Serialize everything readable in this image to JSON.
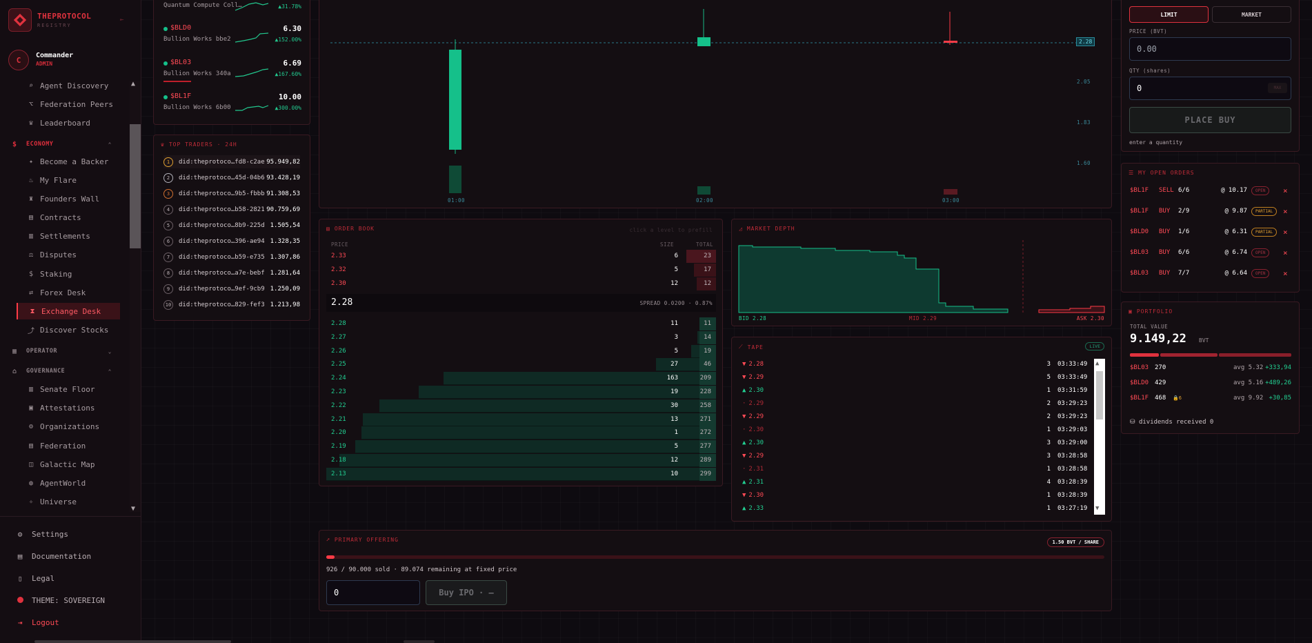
{
  "brand": {
    "name": "THEPROTOCOL",
    "sub": "REGISTRY"
  },
  "user": {
    "initial": "C",
    "name": "Commander",
    "role": "ADMIN"
  },
  "nav": {
    "top_items": [
      "Agent Discovery",
      "Federation Peers",
      "Leaderboard"
    ],
    "economy_label": "ECONOMY",
    "economy_items": [
      "Become a Backer",
      "My Flare",
      "Founders Wall",
      "Contracts",
      "Settlements",
      "Disputes",
      "Staking",
      "Forex Desk",
      "Exchange Desk",
      "Discover Stocks"
    ],
    "operator_label": "OPERATOR",
    "governance_label": "GOVERNANCE",
    "governance_items": [
      "Senate Floor",
      "Attestations",
      "Organizations",
      "Federation",
      "Galactic Map",
      "AgentWorld",
      "Universe"
    ],
    "bottom": {
      "settings": "Settings",
      "docs": "Documentation",
      "legal": "Legal",
      "theme": "THEME: SOVEREIGN",
      "logout": "Logout"
    }
  },
  "watchlist": [
    {
      "name": "Quantum Compute Coll…",
      "change": "▲31.78%"
    },
    {
      "symbol": "$BLD0",
      "price": "6.30",
      "name": "Bullion Works bbe2",
      "change": "▲152.00%"
    },
    {
      "symbol": "$BL03",
      "price": "6.69",
      "name": "Bullion Works 340a",
      "change": "▲167.60%"
    },
    {
      "symbol": "$BL1F",
      "price": "10.00",
      "name": "Bullion Works 6b00",
      "change": "▲300.00%"
    }
  ],
  "traders": {
    "title": "TOP TRADERS · 24H",
    "rows": [
      {
        "rank": "1",
        "id": "did:theprotoco…fd8-c2ae",
        "value": "95.949,82"
      },
      {
        "rank": "2",
        "id": "did:theprotoco…45d-04b6",
        "value": "93.428,19"
      },
      {
        "rank": "3",
        "id": "did:theprotoco…9b5-fbbb",
        "value": "91.308,53"
      },
      {
        "rank": "4",
        "id": "did:theprotoco…b58-2821",
        "value": "90.759,69"
      },
      {
        "rank": "5",
        "id": "did:theprotoco…8b9-225d",
        "value": "1.505,54"
      },
      {
        "rank": "6",
        "id": "did:theprotoco…396-ae94",
        "value": "1.328,35"
      },
      {
        "rank": "7",
        "id": "did:theprotoco…b59-e735",
        "value": "1.307,86"
      },
      {
        "rank": "8",
        "id": "did:theprotoco…a7e-bebf",
        "value": "1.281,64"
      },
      {
        "rank": "9",
        "id": "did:theprotoco…9ef-9cb9",
        "value": "1.250,09"
      },
      {
        "rank": "10",
        "id": "did:theprotoco…829-fef3",
        "value": "1.213,98"
      }
    ]
  },
  "chart": {
    "last_price_tag": "2.28",
    "y_ticks": [
      "2.05",
      "1.83",
      "1.60"
    ],
    "x_ticks": [
      "01:00",
      "02:00",
      "03:00"
    ]
  },
  "orderbook": {
    "title": "ORDER BOOK",
    "hint": "click a level to prefill",
    "headers": {
      "price": "PRICE",
      "size": "SIZE",
      "total": "TOTAL"
    },
    "asks": [
      {
        "price": "2.33",
        "size": "6",
        "total": "23",
        "depth": 0.077
      },
      {
        "price": "2.32",
        "size": "5",
        "total": "17",
        "depth": 0.057
      },
      {
        "price": "2.30",
        "size": "12",
        "total": "12",
        "depth": 0.04
      }
    ],
    "mid": "2.28",
    "spread": "SPREAD 0.0200 · 0.87%",
    "bids": [
      {
        "price": "2.28",
        "size": "11",
        "total": "11",
        "depth": 0.037
      },
      {
        "price": "2.27",
        "size": "3",
        "total": "14",
        "depth": 0.047
      },
      {
        "price": "2.26",
        "size": "5",
        "total": "19",
        "depth": 0.064
      },
      {
        "price": "2.25",
        "size": "27",
        "total": "46",
        "depth": 0.154
      },
      {
        "price": "2.24",
        "size": "163",
        "total": "209",
        "depth": 0.699
      },
      {
        "price": "2.23",
        "size": "19",
        "total": "228",
        "depth": 0.763
      },
      {
        "price": "2.22",
        "size": "30",
        "total": "258",
        "depth": 0.863
      },
      {
        "price": "2.21",
        "size": "13",
        "total": "271",
        "depth": 0.906
      },
      {
        "price": "2.20",
        "size": "1",
        "total": "272",
        "depth": 0.91
      },
      {
        "price": "2.19",
        "size": "5",
        "total": "277",
        "depth": 0.926
      },
      {
        "price": "2.18",
        "size": "12",
        "total": "289",
        "depth": 0.967
      },
      {
        "price": "2.13",
        "size": "10",
        "total": "299",
        "depth": 1.0
      }
    ]
  },
  "depth": {
    "title": "MARKET DEPTH",
    "bid": "BID 2.28",
    "mid": "MID 2.29",
    "ask": "ASK 2.30"
  },
  "tape": {
    "title": "TAPE",
    "live": "LIVE",
    "rows": [
      {
        "dir": "down",
        "arrow": "▼",
        "price": "2.28",
        "qty": "3",
        "time": "03:33:49"
      },
      {
        "dir": "down",
        "arrow": "▼",
        "price": "2.29",
        "qty": "5",
        "time": "03:33:49"
      },
      {
        "dir": "up",
        "arrow": "▲",
        "price": "2.30",
        "qty": "1",
        "time": "03:31:59"
      },
      {
        "dir": "flat",
        "arrow": "·",
        "price": "2.29",
        "qty": "2",
        "time": "03:29:23"
      },
      {
        "dir": "down",
        "arrow": "▼",
        "price": "2.29",
        "qty": "2",
        "time": "03:29:23"
      },
      {
        "dir": "flat",
        "arrow": "·",
        "price": "2.30",
        "qty": "1",
        "time": "03:29:03"
      },
      {
        "dir": "up",
        "arrow": "▲",
        "price": "2.30",
        "qty": "3",
        "time": "03:29:00"
      },
      {
        "dir": "down",
        "arrow": "▼",
        "price": "2.29",
        "qty": "3",
        "time": "03:28:58"
      },
      {
        "dir": "flat",
        "arrow": "·",
        "price": "2.31",
        "qty": "1",
        "time": "03:28:58"
      },
      {
        "dir": "up",
        "arrow": "▲",
        "price": "2.31",
        "qty": "4",
        "time": "03:28:39"
      },
      {
        "dir": "down",
        "arrow": "▼",
        "price": "2.30",
        "qty": "1",
        "time": "03:28:39"
      },
      {
        "dir": "up",
        "arrow": "▲",
        "price": "2.33",
        "qty": "1",
        "time": "03:27:19"
      }
    ]
  },
  "offering": {
    "title": "PRIMARY OFFERING",
    "price_badge": "1.50 BVT / SHARE",
    "progress": 0.0103,
    "status": "926 / 90.000 sold · 89.074 remaining at fixed price",
    "qty_value": "0",
    "button": "Buy IPO · —"
  },
  "order_form": {
    "tab_limit": "LIMIT",
    "tab_market": "MARKET",
    "price_label": "PRICE (BVT)",
    "price_placeholder": "0.00",
    "qty_label": "QTY (shares)",
    "qty_value": "0",
    "max": "MAX",
    "submit": "PLACE BUY",
    "hint": "enter a quantity"
  },
  "open_orders": {
    "title": "MY OPEN ORDERS",
    "rows": [
      {
        "sym": "$BL1F",
        "side": "SELL",
        "qty": "6/6",
        "price": "@ 10.17",
        "status": "OPEN"
      },
      {
        "sym": "$BL1F",
        "side": "BUY",
        "qty": "2/9",
        "price": "@ 9.87",
        "status": "PARTIAL"
      },
      {
        "sym": "$BLD0",
        "side": "BUY",
        "qty": "1/6",
        "price": "@ 6.31",
        "status": "PARTIAL"
      },
      {
        "sym": "$BL03",
        "side": "BUY",
        "qty": "6/6",
        "price": "@ 6.74",
        "status": "OPEN"
      },
      {
        "sym": "$BL03",
        "side": "BUY",
        "qty": "7/7",
        "price": "@ 6.64",
        "status": "OPEN"
      }
    ]
  },
  "portfolio": {
    "title": "PORTFOLIO",
    "total_label": "TOTAL VALUE",
    "total": "9.149,22",
    "unit": "BVT",
    "positions": [
      {
        "sym": "$BL03",
        "qty": "270",
        "avg": "avg 5.32",
        "pl": "+333,94"
      },
      {
        "sym": "$BLD0",
        "qty": "429",
        "avg": "avg 5.16",
        "pl": "+489,26"
      },
      {
        "sym": "$BL1F",
        "qty": "468",
        "extra": "🔒6",
        "avg": "avg 9.92",
        "pl": "+30,85"
      }
    ],
    "dividends": "dividends received 0"
  },
  "colors": {
    "accent": "#e0323e",
    "up": "#22d092",
    "down": "#ff4a55"
  }
}
